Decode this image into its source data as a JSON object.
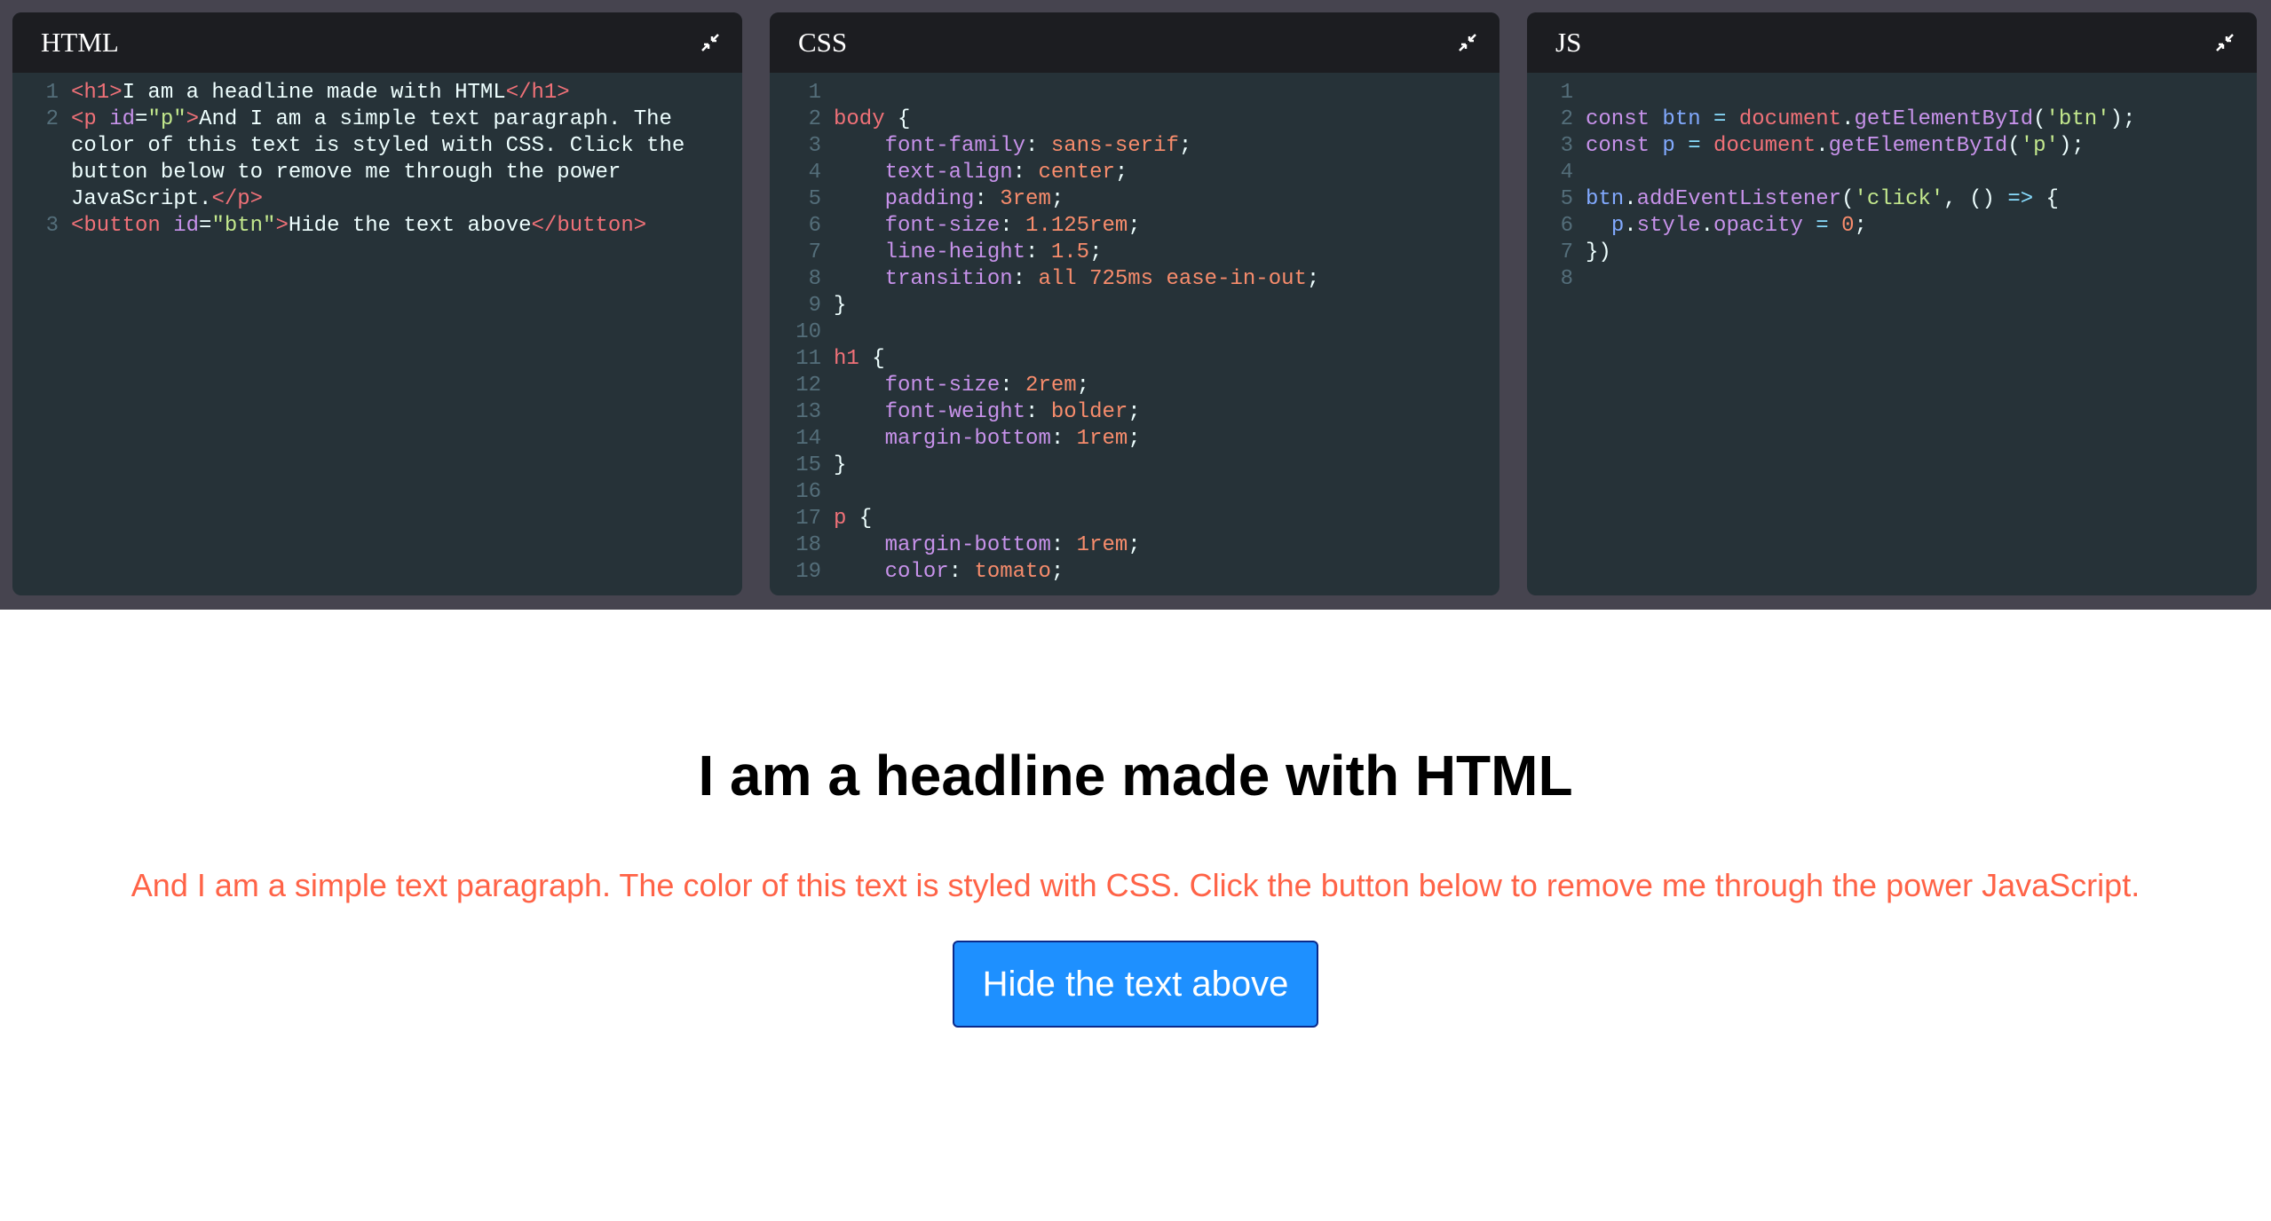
{
  "panels": {
    "html": {
      "title": "HTML",
      "lines": [
        {
          "n": "1",
          "segs": [
            {
              "c": "tag",
              "t": "<h1>"
            },
            {
              "c": "plain",
              "t": "I am a headline made with HTML"
            },
            {
              "c": "tag",
              "t": "</h1>"
            }
          ]
        },
        {
          "n": "2",
          "segs": [
            {
              "c": "tag",
              "t": "<p "
            },
            {
              "c": "attr",
              "t": "id"
            },
            {
              "c": "plain",
              "t": "="
            },
            {
              "c": "str",
              "t": "\"p\""
            },
            {
              "c": "tag",
              "t": ">"
            },
            {
              "c": "plain",
              "t": "And I am a simple text paragraph. The color of this text is styled with CSS. Click the button below to remove me through the power JavaScript."
            },
            {
              "c": "tag",
              "t": "</p>"
            }
          ]
        },
        {
          "n": "3",
          "segs": [
            {
              "c": "tag",
              "t": "<button "
            },
            {
              "c": "attr",
              "t": "id"
            },
            {
              "c": "plain",
              "t": "="
            },
            {
              "c": "str",
              "t": "\"btn\""
            },
            {
              "c": "tag",
              "t": ">"
            },
            {
              "c": "plain",
              "t": "Hide the text above"
            },
            {
              "c": "tag",
              "t": "</button>"
            }
          ]
        }
      ]
    },
    "css": {
      "title": "CSS",
      "lines": [
        {
          "n": "1",
          "segs": []
        },
        {
          "n": "2",
          "segs": [
            {
              "c": "tag",
              "t": "body"
            },
            {
              "c": "plain",
              "t": " {"
            }
          ]
        },
        {
          "n": "3",
          "segs": [
            {
              "c": "plain",
              "t": "    "
            },
            {
              "c": "prop",
              "t": "font-family"
            },
            {
              "c": "plain",
              "t": ": "
            },
            {
              "c": "val",
              "t": "sans-serif"
            },
            {
              "c": "plain",
              "t": ";"
            }
          ]
        },
        {
          "n": "4",
          "segs": [
            {
              "c": "plain",
              "t": "    "
            },
            {
              "c": "prop",
              "t": "text-align"
            },
            {
              "c": "plain",
              "t": ": "
            },
            {
              "c": "val",
              "t": "center"
            },
            {
              "c": "plain",
              "t": ";"
            }
          ]
        },
        {
          "n": "5",
          "segs": [
            {
              "c": "plain",
              "t": "    "
            },
            {
              "c": "prop",
              "t": "padding"
            },
            {
              "c": "plain",
              "t": ": "
            },
            {
              "c": "num",
              "t": "3rem"
            },
            {
              "c": "plain",
              "t": ";"
            }
          ]
        },
        {
          "n": "6",
          "segs": [
            {
              "c": "plain",
              "t": "    "
            },
            {
              "c": "prop",
              "t": "font-size"
            },
            {
              "c": "plain",
              "t": ": "
            },
            {
              "c": "num",
              "t": "1.125rem"
            },
            {
              "c": "plain",
              "t": ";"
            }
          ]
        },
        {
          "n": "7",
          "segs": [
            {
              "c": "plain",
              "t": "    "
            },
            {
              "c": "prop",
              "t": "line-height"
            },
            {
              "c": "plain",
              "t": ": "
            },
            {
              "c": "num",
              "t": "1.5"
            },
            {
              "c": "plain",
              "t": ";"
            }
          ]
        },
        {
          "n": "8",
          "segs": [
            {
              "c": "plain",
              "t": "    "
            },
            {
              "c": "prop",
              "t": "transition"
            },
            {
              "c": "plain",
              "t": ": "
            },
            {
              "c": "val",
              "t": "all 725ms ease-in-out"
            },
            {
              "c": "plain",
              "t": ";"
            }
          ]
        },
        {
          "n": "9",
          "segs": [
            {
              "c": "plain",
              "t": "}"
            }
          ]
        },
        {
          "n": "10",
          "segs": []
        },
        {
          "n": "11",
          "segs": [
            {
              "c": "tag",
              "t": "h1"
            },
            {
              "c": "plain",
              "t": " {"
            }
          ]
        },
        {
          "n": "12",
          "segs": [
            {
              "c": "plain",
              "t": "    "
            },
            {
              "c": "prop",
              "t": "font-size"
            },
            {
              "c": "plain",
              "t": ": "
            },
            {
              "c": "num",
              "t": "2rem"
            },
            {
              "c": "plain",
              "t": ";"
            }
          ]
        },
        {
          "n": "13",
          "segs": [
            {
              "c": "plain",
              "t": "    "
            },
            {
              "c": "prop",
              "t": "font-weight"
            },
            {
              "c": "plain",
              "t": ": "
            },
            {
              "c": "val",
              "t": "bolder"
            },
            {
              "c": "plain",
              "t": ";"
            }
          ]
        },
        {
          "n": "14",
          "segs": [
            {
              "c": "plain",
              "t": "    "
            },
            {
              "c": "prop",
              "t": "margin-bottom"
            },
            {
              "c": "plain",
              "t": ": "
            },
            {
              "c": "num",
              "t": "1rem"
            },
            {
              "c": "plain",
              "t": ";"
            }
          ]
        },
        {
          "n": "15",
          "segs": [
            {
              "c": "plain",
              "t": "}"
            }
          ]
        },
        {
          "n": "16",
          "segs": []
        },
        {
          "n": "17",
          "segs": [
            {
              "c": "tag",
              "t": "p"
            },
            {
              "c": "plain",
              "t": " {"
            }
          ]
        },
        {
          "n": "18",
          "segs": [
            {
              "c": "plain",
              "t": "    "
            },
            {
              "c": "prop",
              "t": "margin-bottom"
            },
            {
              "c": "plain",
              "t": ": "
            },
            {
              "c": "num",
              "t": "1rem"
            },
            {
              "c": "plain",
              "t": ";"
            }
          ]
        },
        {
          "n": "19",
          "segs": [
            {
              "c": "plain",
              "t": "    "
            },
            {
              "c": "prop",
              "t": "color"
            },
            {
              "c": "plain",
              "t": ": "
            },
            {
              "c": "val",
              "t": "tomato"
            },
            {
              "c": "plain",
              "t": ";"
            }
          ]
        }
      ]
    },
    "js": {
      "title": "JS",
      "lines": [
        {
          "n": "1",
          "segs": []
        },
        {
          "n": "2",
          "segs": [
            {
              "c": "kw",
              "t": "const "
            },
            {
              "c": "var",
              "t": "btn"
            },
            {
              "c": "op",
              "t": " = "
            },
            {
              "c": "ident",
              "t": "document"
            },
            {
              "c": "plain",
              "t": "."
            },
            {
              "c": "attr",
              "t": "getElementById"
            },
            {
              "c": "plain",
              "t": "("
            },
            {
              "c": "str",
              "t": "'btn'"
            },
            {
              "c": "plain",
              "t": ");"
            }
          ]
        },
        {
          "n": "3",
          "segs": [
            {
              "c": "kw",
              "t": "const "
            },
            {
              "c": "var",
              "t": "p"
            },
            {
              "c": "op",
              "t": " = "
            },
            {
              "c": "ident",
              "t": "document"
            },
            {
              "c": "plain",
              "t": "."
            },
            {
              "c": "attr",
              "t": "getElementById"
            },
            {
              "c": "plain",
              "t": "("
            },
            {
              "c": "str",
              "t": "'p'"
            },
            {
              "c": "plain",
              "t": ");"
            }
          ]
        },
        {
          "n": "4",
          "segs": []
        },
        {
          "n": "5",
          "segs": [
            {
              "c": "var",
              "t": "btn"
            },
            {
              "c": "plain",
              "t": "."
            },
            {
              "c": "attr",
              "t": "addEventListener"
            },
            {
              "c": "plain",
              "t": "("
            },
            {
              "c": "str",
              "t": "'click'"
            },
            {
              "c": "plain",
              "t": ", () "
            },
            {
              "c": "op",
              "t": "=>"
            },
            {
              "c": "plain",
              "t": " {"
            }
          ]
        },
        {
          "n": "6",
          "segs": [
            {
              "c": "plain",
              "t": "  "
            },
            {
              "c": "var",
              "t": "p"
            },
            {
              "c": "plain",
              "t": "."
            },
            {
              "c": "attr",
              "t": "style"
            },
            {
              "c": "plain",
              "t": "."
            },
            {
              "c": "attr",
              "t": "opacity"
            },
            {
              "c": "op",
              "t": " = "
            },
            {
              "c": "num",
              "t": "0"
            },
            {
              "c": "plain",
              "t": ";"
            }
          ]
        },
        {
          "n": "7",
          "segs": [
            {
              "c": "plain",
              "t": "})"
            }
          ]
        },
        {
          "n": "8",
          "segs": []
        }
      ]
    }
  },
  "preview": {
    "headline": "I am a headline made with HTML",
    "paragraph": "And I am a simple text paragraph. The color of this text is styled with CSS. Click the button below to remove me through the power JavaScript.",
    "button_label": "Hide the text above"
  },
  "icons": {
    "collapse": "collapse-arrows-icon"
  }
}
